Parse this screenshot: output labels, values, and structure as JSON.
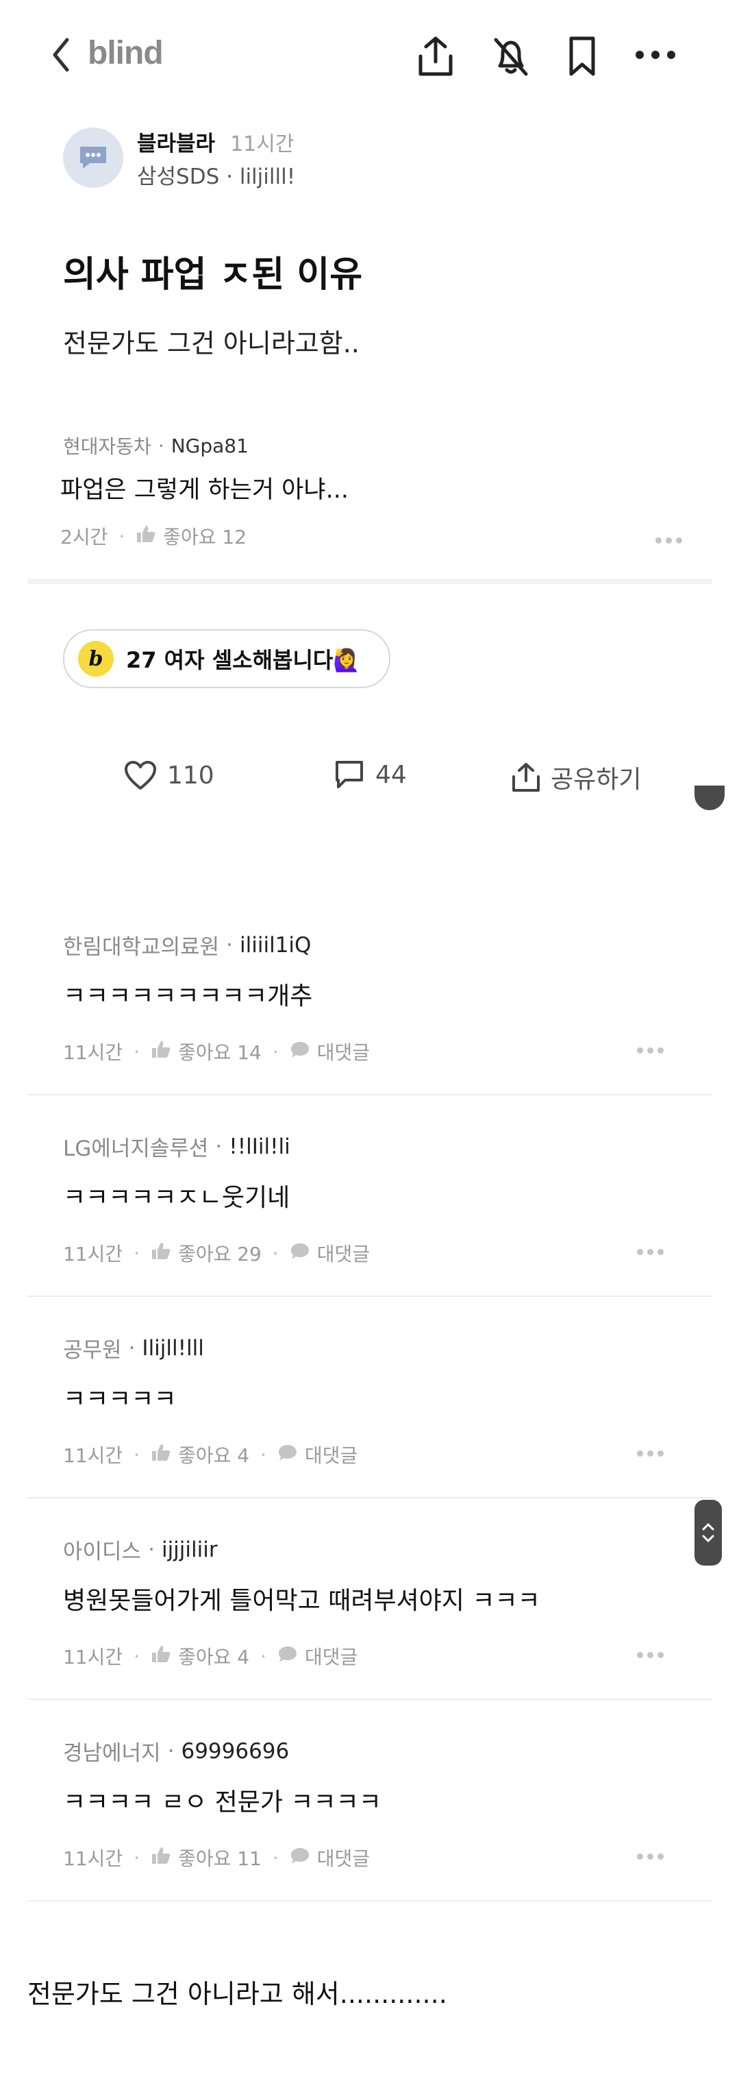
{
  "topbar": {
    "logo": "blind",
    "icons": [
      "back-icon",
      "share-icon",
      "bell-off-icon",
      "bookmark-icon",
      "more-icon"
    ]
  },
  "author": {
    "name": "블라블라",
    "time": "11시간",
    "company": "삼성SDS · liljilll!"
  },
  "post": {
    "title": "의사 파업 ㅈ된 이유",
    "body": "전문가도 그건 아니라고함.."
  },
  "quoted_comment": {
    "company": "현대자동차",
    "nick": "NGpa81",
    "text": "파업은 그렇게 하는거 아냐...",
    "time": "2시간",
    "likes": "좋아요 12"
  },
  "promo": {
    "badge": "b",
    "label": "27 여자 셀소해봅니다🙋‍♀️"
  },
  "actions": {
    "likes": "110",
    "comments": "44",
    "share": "공유하기"
  },
  "comments": [
    {
      "company": "한림대학교의료원",
      "nick": "iliiil1iQ",
      "text": "ㅋㅋㅋㅋㅋㅋㅋㅋㅋ개추",
      "time": "11시간",
      "likes": "좋아요 14",
      "reply": "대댓글"
    },
    {
      "company": "LG에너지솔루션",
      "nick": "!!lIil!li",
      "text": "ㅋㅋㅋㅋㅋㅈㄴ웃기네",
      "time": "11시간",
      "likes": "좋아요 29",
      "reply": "대댓글"
    },
    {
      "company": "공무원",
      "nick": "Ilijll!lll",
      "text": "ㅋㅋㅋㅋㅋ",
      "time": "11시간",
      "likes": "좋아요 4",
      "reply": "대댓글"
    },
    {
      "company": "아이디스",
      "nick": "ijjjiliir",
      "text": "병원못들어가게 틀어막고 때려부셔야지 ㅋㅋㅋ",
      "time": "11시간",
      "likes": "좋아요 4",
      "reply": "대댓글"
    },
    {
      "company": "경남에너지",
      "nick": "69996696",
      "text": "ㅋㅋㅋㅋ ㄹㅇ 전문가 ㅋㅋㅋㅋ",
      "time": "11시간",
      "likes": "좋아요 11",
      "reply": "대댓글"
    }
  ],
  "bottom_caption": "전문가도 그건 아니라고 해서............."
}
